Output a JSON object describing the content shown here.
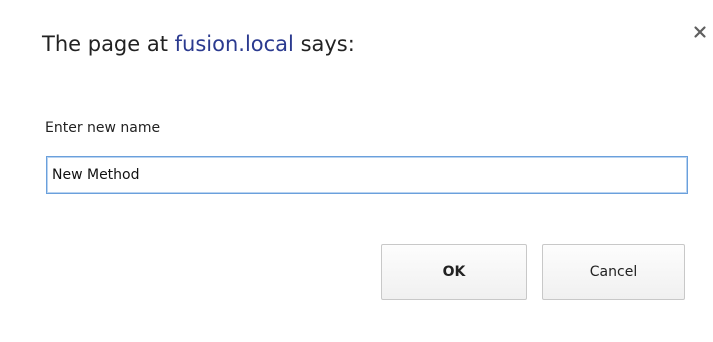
{
  "dialog": {
    "title_prefix": "The page at ",
    "title_host": "fusion.local",
    "title_suffix": " says:",
    "close_glyph": "×",
    "prompt_label": "Enter new name",
    "input_value": "New Method",
    "ok_label": "OK",
    "cancel_label": "Cancel"
  },
  "icons": {
    "close": "close-icon"
  },
  "colors": {
    "input_focus_border": "#6aa0dc",
    "title_host": "#2b3a8f"
  }
}
